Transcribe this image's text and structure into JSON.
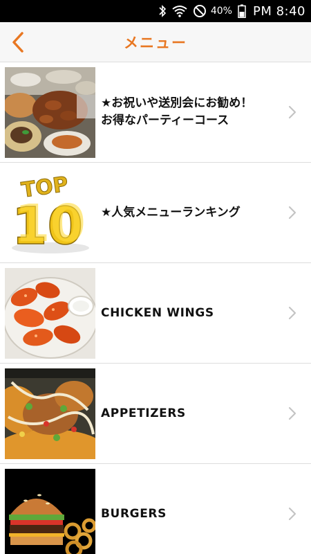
{
  "status_bar": {
    "battery": "40%",
    "time": "PM 8:40",
    "icons": [
      "bluetooth-icon",
      "wifi-icon",
      "do-not-disturb-icon",
      "battery-icon"
    ]
  },
  "header": {
    "title": "メニュー",
    "back_icon": "chevron-left-icon",
    "accent_color": "#e87722"
  },
  "menu": {
    "items": [
      {
        "label": "★お祝いや送別会にお勧め！\nお得なパーティーコース",
        "image": "party-course-photo"
      },
      {
        "label": "★人気メニューランキング",
        "image": "top-10-graphic",
        "image_text": "TOP 10"
      },
      {
        "label": "CHICKEN WINGS",
        "image": "chicken-wings-photo"
      },
      {
        "label": "APPETIZERS",
        "image": "appetizers-photo"
      },
      {
        "label": "BURGERS",
        "image": "burgers-photo"
      }
    ]
  }
}
